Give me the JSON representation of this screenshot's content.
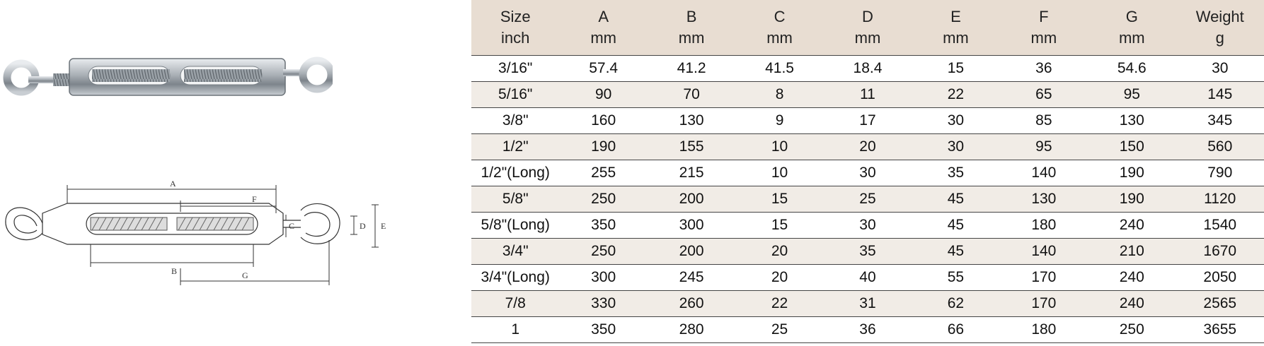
{
  "diagram": {
    "labels": {
      "A": "A",
      "B": "B",
      "C": "C",
      "D": "D",
      "E": "E",
      "F": "F",
      "G": "G"
    }
  },
  "table": {
    "headers": [
      {
        "line1": "Size",
        "line2": "inch"
      },
      {
        "line1": "A",
        "line2": "mm"
      },
      {
        "line1": "B",
        "line2": "mm"
      },
      {
        "line1": "C",
        "line2": "mm"
      },
      {
        "line1": "D",
        "line2": "mm"
      },
      {
        "line1": "E",
        "line2": "mm"
      },
      {
        "line1": "F",
        "line2": "mm"
      },
      {
        "line1": "G",
        "line2": "mm"
      },
      {
        "line1": "Weight",
        "line2": "g"
      }
    ],
    "rows": [
      [
        "3/16\"",
        "57.4",
        "41.2",
        "41.5",
        "18.4",
        "15",
        "36",
        "54.6",
        "30"
      ],
      [
        "5/16\"",
        "90",
        "70",
        "8",
        "11",
        "22",
        "65",
        "95",
        "145"
      ],
      [
        "3/8\"",
        "160",
        "130",
        "9",
        "17",
        "30",
        "85",
        "130",
        "345"
      ],
      [
        "1/2\"",
        "190",
        "155",
        "10",
        "20",
        "30",
        "95",
        "150",
        "560"
      ],
      [
        "1/2\"(Long)",
        "255",
        "215",
        "10",
        "30",
        "35",
        "140",
        "190",
        "790"
      ],
      [
        "5/8\"",
        "250",
        "200",
        "15",
        "25",
        "45",
        "130",
        "190",
        "1120"
      ],
      [
        "5/8\"(Long)",
        "350",
        "300",
        "15",
        "30",
        "45",
        "180",
        "240",
        "1540"
      ],
      [
        "3/4\"",
        "250",
        "200",
        "20",
        "35",
        "45",
        "140",
        "210",
        "1670"
      ],
      [
        "3/4\"(Long)",
        "300",
        "245",
        "20",
        "40",
        "55",
        "170",
        "240",
        "2050"
      ],
      [
        "7/8",
        "330",
        "260",
        "22",
        "31",
        "62",
        "170",
        "240",
        "2565"
      ],
      [
        "1",
        "350",
        "280",
        "25",
        "36",
        "66",
        "180",
        "250",
        "3655"
      ]
    ]
  }
}
